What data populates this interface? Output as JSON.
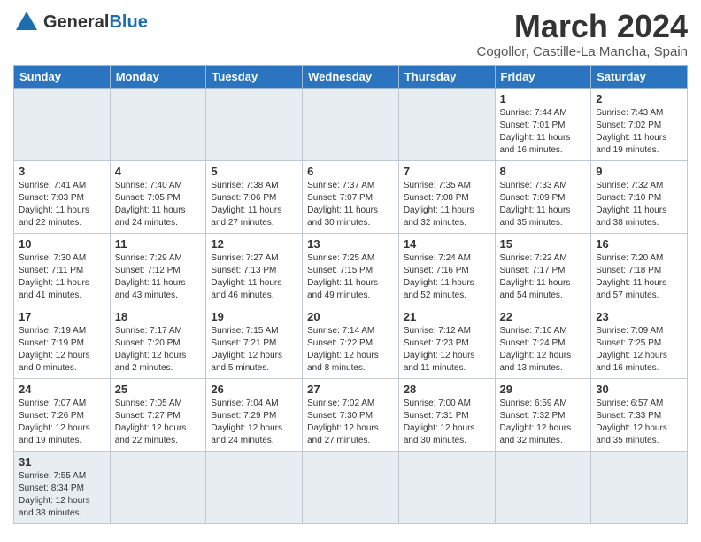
{
  "logo": {
    "text_general": "General",
    "text_blue": "Blue"
  },
  "header": {
    "title": "March 2024",
    "subtitle": "Cogollor, Castille-La Mancha, Spain"
  },
  "weekdays": [
    "Sunday",
    "Monday",
    "Tuesday",
    "Wednesday",
    "Thursday",
    "Friday",
    "Saturday"
  ],
  "days": {
    "d1": {
      "num": "1",
      "info": "Sunrise: 7:44 AM\nSunset: 7:01 PM\nDaylight: 11 hours\nand 16 minutes."
    },
    "d2": {
      "num": "2",
      "info": "Sunrise: 7:43 AM\nSunset: 7:02 PM\nDaylight: 11 hours\nand 19 minutes."
    },
    "d3": {
      "num": "3",
      "info": "Sunrise: 7:41 AM\nSunset: 7:03 PM\nDaylight: 11 hours\nand 22 minutes."
    },
    "d4": {
      "num": "4",
      "info": "Sunrise: 7:40 AM\nSunset: 7:05 PM\nDaylight: 11 hours\nand 24 minutes."
    },
    "d5": {
      "num": "5",
      "info": "Sunrise: 7:38 AM\nSunset: 7:06 PM\nDaylight: 11 hours\nand 27 minutes."
    },
    "d6": {
      "num": "6",
      "info": "Sunrise: 7:37 AM\nSunset: 7:07 PM\nDaylight: 11 hours\nand 30 minutes."
    },
    "d7": {
      "num": "7",
      "info": "Sunrise: 7:35 AM\nSunset: 7:08 PM\nDaylight: 11 hours\nand 32 minutes."
    },
    "d8": {
      "num": "8",
      "info": "Sunrise: 7:33 AM\nSunset: 7:09 PM\nDaylight: 11 hours\nand 35 minutes."
    },
    "d9": {
      "num": "9",
      "info": "Sunrise: 7:32 AM\nSunset: 7:10 PM\nDaylight: 11 hours\nand 38 minutes."
    },
    "d10": {
      "num": "10",
      "info": "Sunrise: 7:30 AM\nSunset: 7:11 PM\nDaylight: 11 hours\nand 41 minutes."
    },
    "d11": {
      "num": "11",
      "info": "Sunrise: 7:29 AM\nSunset: 7:12 PM\nDaylight: 11 hours\nand 43 minutes."
    },
    "d12": {
      "num": "12",
      "info": "Sunrise: 7:27 AM\nSunset: 7:13 PM\nDaylight: 11 hours\nand 46 minutes."
    },
    "d13": {
      "num": "13",
      "info": "Sunrise: 7:25 AM\nSunset: 7:15 PM\nDaylight: 11 hours\nand 49 minutes."
    },
    "d14": {
      "num": "14",
      "info": "Sunrise: 7:24 AM\nSunset: 7:16 PM\nDaylight: 11 hours\nand 52 minutes."
    },
    "d15": {
      "num": "15",
      "info": "Sunrise: 7:22 AM\nSunset: 7:17 PM\nDaylight: 11 hours\nand 54 minutes."
    },
    "d16": {
      "num": "16",
      "info": "Sunrise: 7:20 AM\nSunset: 7:18 PM\nDaylight: 11 hours\nand 57 minutes."
    },
    "d17": {
      "num": "17",
      "info": "Sunrise: 7:19 AM\nSunset: 7:19 PM\nDaylight: 12 hours\nand 0 minutes."
    },
    "d18": {
      "num": "18",
      "info": "Sunrise: 7:17 AM\nSunset: 7:20 PM\nDaylight: 12 hours\nand 2 minutes."
    },
    "d19": {
      "num": "19",
      "info": "Sunrise: 7:15 AM\nSunset: 7:21 PM\nDaylight: 12 hours\nand 5 minutes."
    },
    "d20": {
      "num": "20",
      "info": "Sunrise: 7:14 AM\nSunset: 7:22 PM\nDaylight: 12 hours\nand 8 minutes."
    },
    "d21": {
      "num": "21",
      "info": "Sunrise: 7:12 AM\nSunset: 7:23 PM\nDaylight: 12 hours\nand 11 minutes."
    },
    "d22": {
      "num": "22",
      "info": "Sunrise: 7:10 AM\nSunset: 7:24 PM\nDaylight: 12 hours\nand 13 minutes."
    },
    "d23": {
      "num": "23",
      "info": "Sunrise: 7:09 AM\nSunset: 7:25 PM\nDaylight: 12 hours\nand 16 minutes."
    },
    "d24": {
      "num": "24",
      "info": "Sunrise: 7:07 AM\nSunset: 7:26 PM\nDaylight: 12 hours\nand 19 minutes."
    },
    "d25": {
      "num": "25",
      "info": "Sunrise: 7:05 AM\nSunset: 7:27 PM\nDaylight: 12 hours\nand 22 minutes."
    },
    "d26": {
      "num": "26",
      "info": "Sunrise: 7:04 AM\nSunset: 7:29 PM\nDaylight: 12 hours\nand 24 minutes."
    },
    "d27": {
      "num": "27",
      "info": "Sunrise: 7:02 AM\nSunset: 7:30 PM\nDaylight: 12 hours\nand 27 minutes."
    },
    "d28": {
      "num": "28",
      "info": "Sunrise: 7:00 AM\nSunset: 7:31 PM\nDaylight: 12 hours\nand 30 minutes."
    },
    "d29": {
      "num": "29",
      "info": "Sunrise: 6:59 AM\nSunset: 7:32 PM\nDaylight: 12 hours\nand 32 minutes."
    },
    "d30": {
      "num": "30",
      "info": "Sunrise: 6:57 AM\nSunset: 7:33 PM\nDaylight: 12 hours\nand 35 minutes."
    },
    "d31": {
      "num": "31",
      "info": "Sunrise: 7:55 AM\nSunset: 8:34 PM\nDaylight: 12 hours\nand 38 minutes."
    }
  }
}
